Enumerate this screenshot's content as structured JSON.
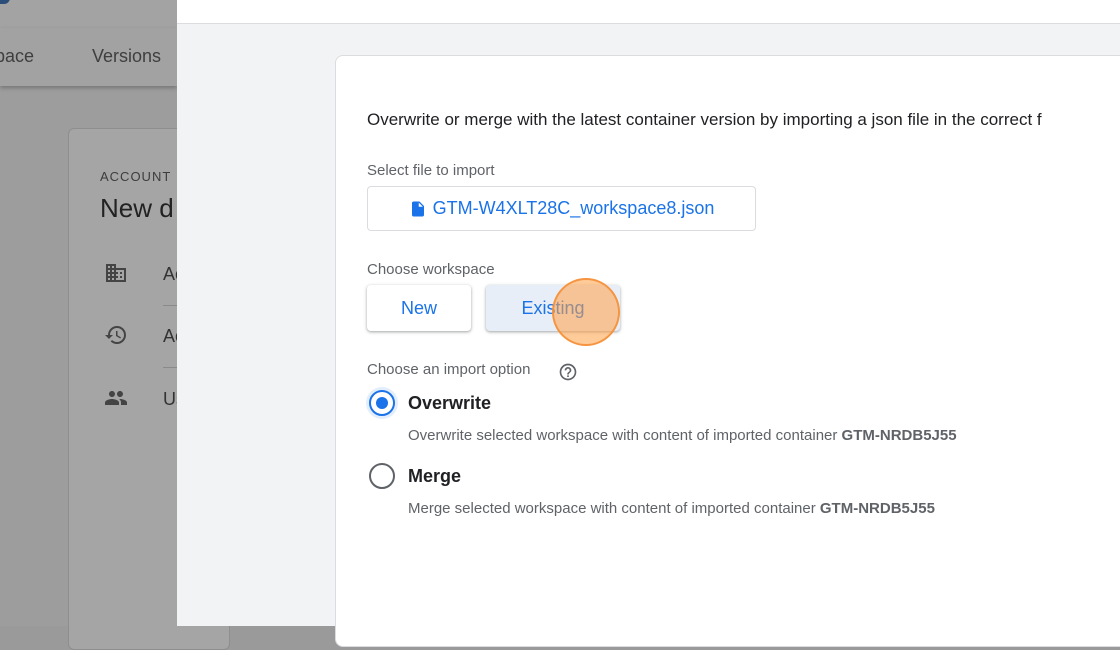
{
  "background": {
    "tabs": [
      "space",
      "Versions"
    ],
    "account_label": "ACCOUNT",
    "account_name": "New d",
    "rows": [
      {
        "icon": "building-icon",
        "text": "Ac"
      },
      {
        "icon": "history-icon",
        "text": "Ac"
      },
      {
        "icon": "users-icon",
        "text": "Us"
      }
    ]
  },
  "dialog": {
    "intro": "Overwrite or merge with the latest container version by importing a json file in the correct f",
    "file_label": "Select file to import",
    "file_name": "GTM-W4XLT28C_workspace8.json",
    "file_icon": "file-icon",
    "workspace_label": "Choose workspace",
    "workspace_options": [
      "New",
      "Existing"
    ],
    "selected_workspace": "Existing",
    "import_label": "Choose an import option",
    "help_icon": "help-icon",
    "options": [
      {
        "label": "Overwrite",
        "desc": "Overwrite selected workspace with content of imported container",
        "container": "GTM-NRDB5J55",
        "selected": true
      },
      {
        "label": "Merge",
        "desc": "Merge selected workspace with content of imported container",
        "container": "GTM-NRDB5J55",
        "selected": false
      }
    ]
  },
  "colors": {
    "accent": "#1a73e8",
    "click_indicator": "#f5a04a"
  }
}
